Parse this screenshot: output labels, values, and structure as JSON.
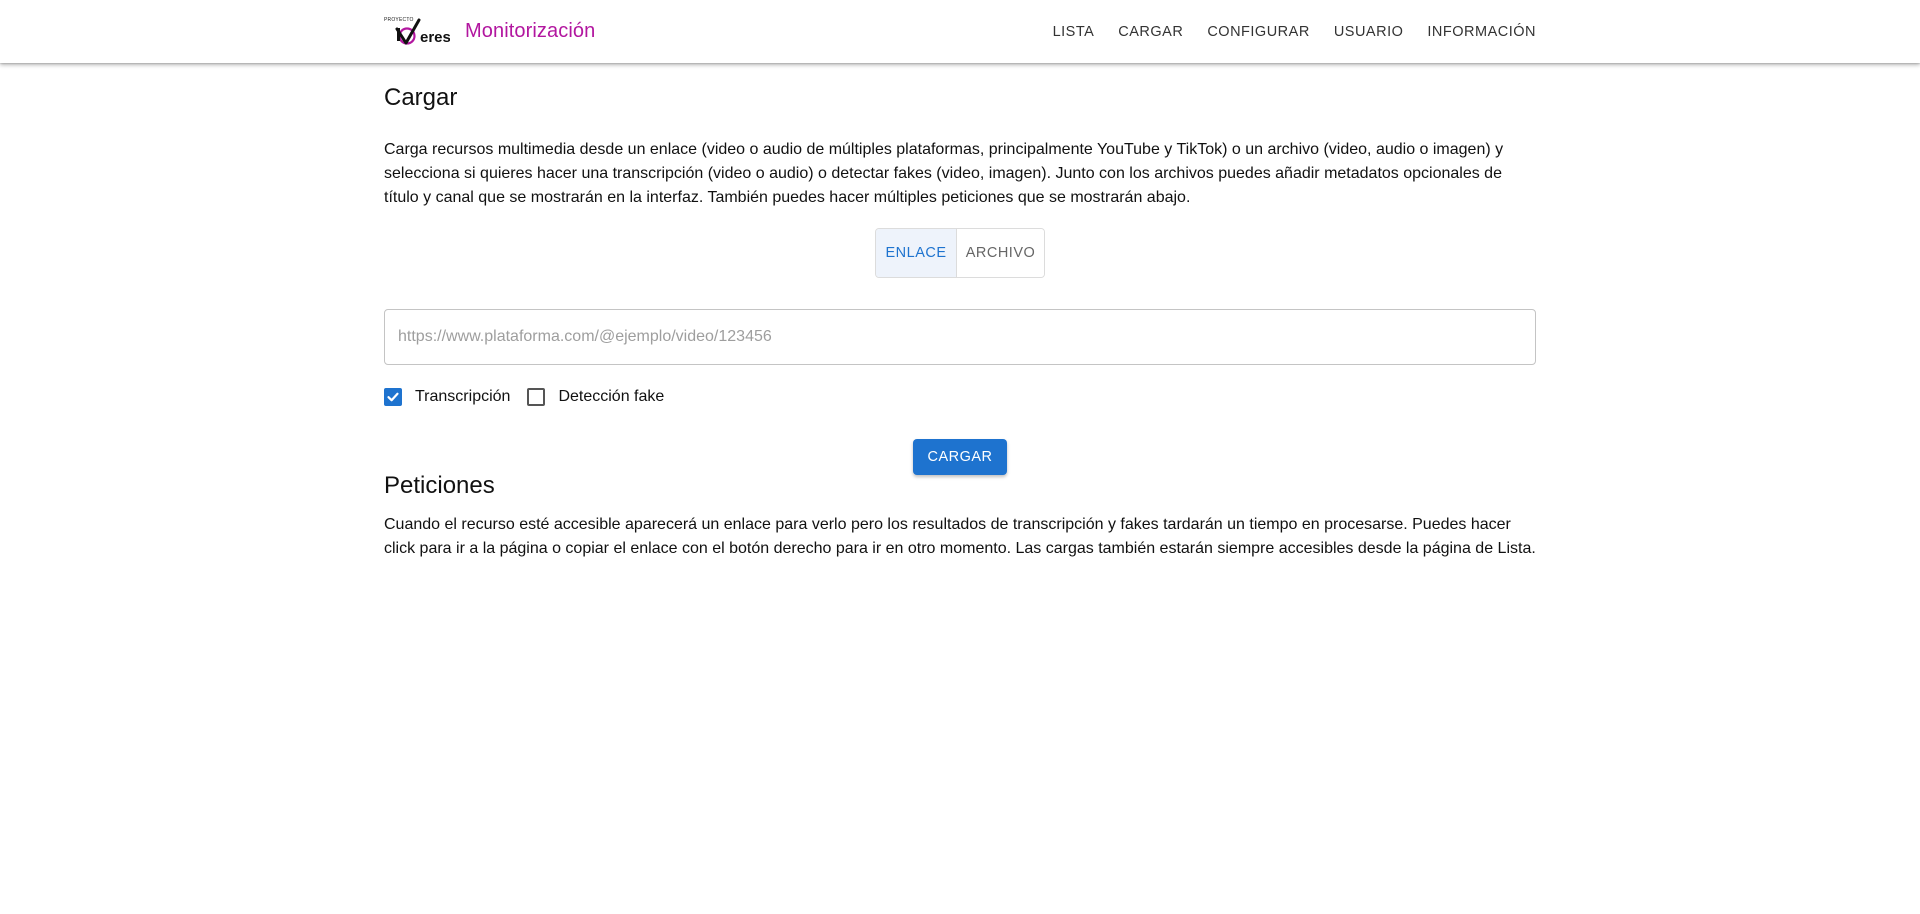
{
  "header": {
    "logo_small_text": "PROYECTO",
    "logo_text": "iVeres",
    "app_title": "Monitorización",
    "nav": [
      {
        "label": "LISTA"
      },
      {
        "label": "CARGAR"
      },
      {
        "label": "CONFIGURAR"
      },
      {
        "label": "USUARIO"
      },
      {
        "label": "INFORMACIÓN"
      }
    ]
  },
  "page": {
    "title": "Cargar",
    "description": "Carga recursos multimedia desde un enlace (video o audio de múltiples plataformas, principalmente YouTube y TikTok) o un archivo (video, audio o imagen) y selecciona si quieres hacer una transcripción (video o audio) o detectar fakes (video, imagen). Junto con los archivos puedes añadir metadatos opcionales de título y canal que se mostrarán en la interfaz. También puedes hacer múltiples peticiones que se mostrarán abajo."
  },
  "source_toggle": {
    "options": [
      {
        "label": "ENLACE",
        "selected": true
      },
      {
        "label": "ARCHIVO",
        "selected": false
      }
    ]
  },
  "url_input": {
    "value": "",
    "placeholder": "https://www.plataforma.com/@ejemplo/video/123456"
  },
  "options": [
    {
      "label": "Transcripción",
      "checked": true
    },
    {
      "label": "Detección fake",
      "checked": false
    }
  ],
  "submit_label": "CARGAR",
  "requests": {
    "title": "Peticiones",
    "text": "Cuando el recurso esté accesible aparecerá un enlace para verlo pero los resultados de transcripción y fakes tardarán un tiempo en procesarse. Puedes hacer click para ir a la página o copiar el enlace con el botón derecho para ir en otro momento. Las cargas también estarán siempre accesibles desde la página de Lista."
  },
  "colors": {
    "brand": "#b2169f",
    "primary": "#1e73cf",
    "toggle_selected_bg": "#eef3fb"
  }
}
